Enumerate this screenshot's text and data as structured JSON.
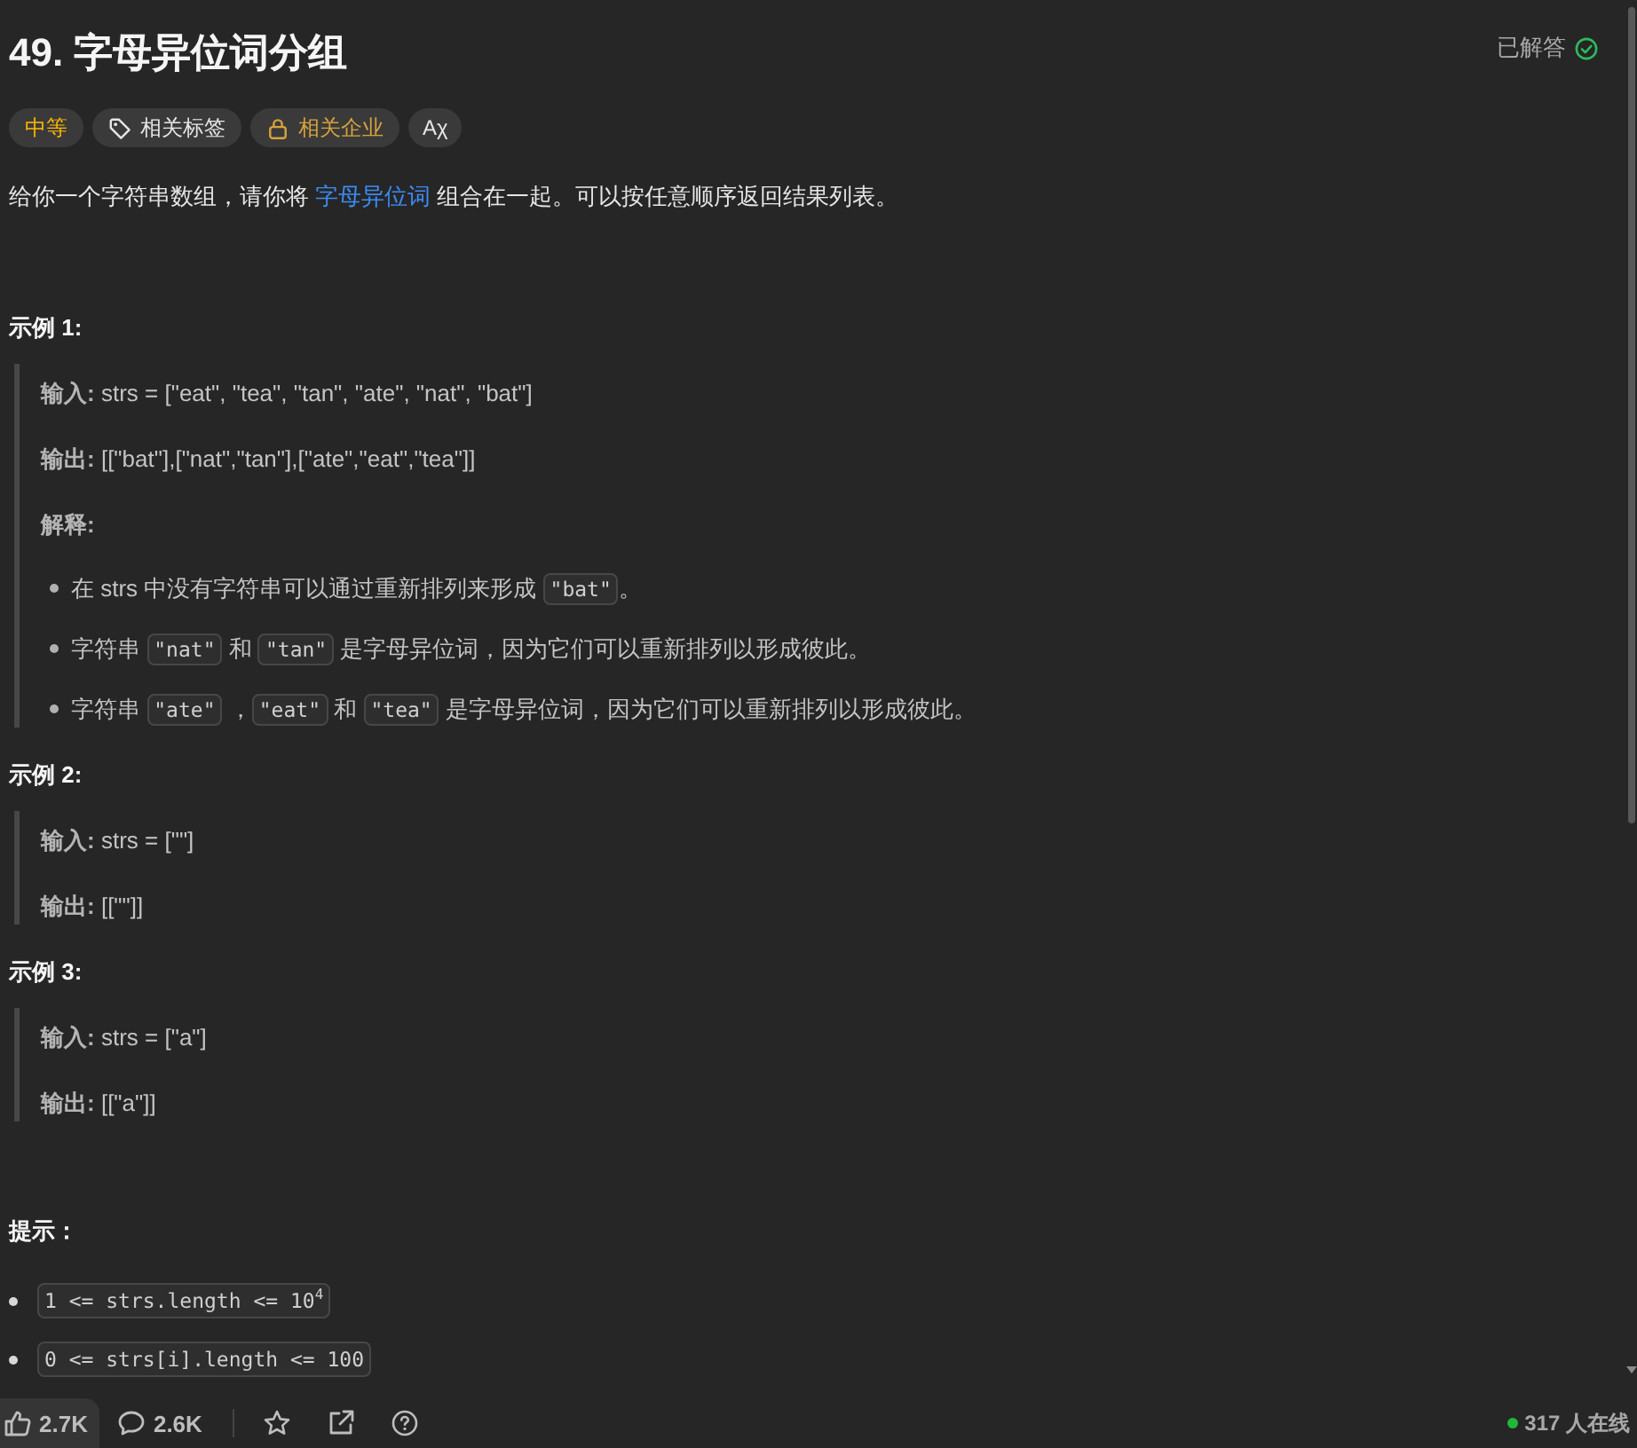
{
  "title": "49. 字母异位词分组",
  "status": {
    "label": "已解答",
    "solved": true
  },
  "tags": [
    {
      "kind": "difficulty",
      "label": "中等"
    },
    {
      "kind": "topics",
      "label": "相关标签"
    },
    {
      "kind": "companies",
      "label": "相关企业"
    },
    {
      "kind": "translate",
      "label": "Aχ"
    }
  ],
  "description": [
    {
      "kind": "text",
      "text": "给你一个字符串数组，请你将 "
    },
    {
      "kind": "link",
      "text": "字母异位词"
    },
    {
      "kind": "text",
      "text": " 组合在一起。可以按任意顺序返回结果列表。"
    }
  ],
  "examples": [
    {
      "heading": "示例 1:",
      "lines": [
        "**输入:** strs = [\"eat\", \"tea\", \"tan\", \"ate\", \"nat\", \"bat\"]",
        "**输出:** [[\"bat\"],[\"nat\",\"tan\"],[\"ate\",\"eat\",\"tea\"]]"
      ],
      "explanation_heading": "解释:",
      "explanation": [
        [
          {
            "kind": "text",
            "text": "在 strs 中没有字符串可以通过重新排列来形成 "
          },
          {
            "kind": "code",
            "text": "\"bat\""
          },
          {
            "kind": "text",
            "text": "。"
          }
        ],
        [
          {
            "kind": "text",
            "text": "字符串 "
          },
          {
            "kind": "code",
            "text": "\"nat\""
          },
          {
            "kind": "text",
            "text": " 和 "
          },
          {
            "kind": "code",
            "text": "\"tan\""
          },
          {
            "kind": "text",
            "text": " 是字母异位词，因为它们可以重新排列以形成彼此。"
          }
        ],
        [
          {
            "kind": "text",
            "text": "字符串 "
          },
          {
            "kind": "code",
            "text": "\"ate\""
          },
          {
            "kind": "text",
            "text": " ，"
          },
          {
            "kind": "code",
            "text": "\"eat\""
          },
          {
            "kind": "text",
            "text": " 和 "
          },
          {
            "kind": "code",
            "text": "\"tea\""
          },
          {
            "kind": "text",
            "text": " 是字母异位词，因为它们可以重新排列以形成彼此。"
          }
        ]
      ]
    },
    {
      "heading": "示例 2:",
      "lines": [
        "**输入:** strs = [\"\"]",
        "**输出:** [[\"\"]]"
      ]
    },
    {
      "heading": "示例 3:",
      "lines": [
        "**输入:** strs = [\"a\"]",
        "**输出:** [[\"a\"]]"
      ]
    }
  ],
  "constraints_heading": "提示：",
  "constraints": [
    "1 <= strs.length <= 10$^{4}$",
    "0 <= strs[i].length <= 100"
  ],
  "footer": {
    "likes": "2.7K",
    "comments": "2.6K",
    "online": "317 人在线"
  }
}
